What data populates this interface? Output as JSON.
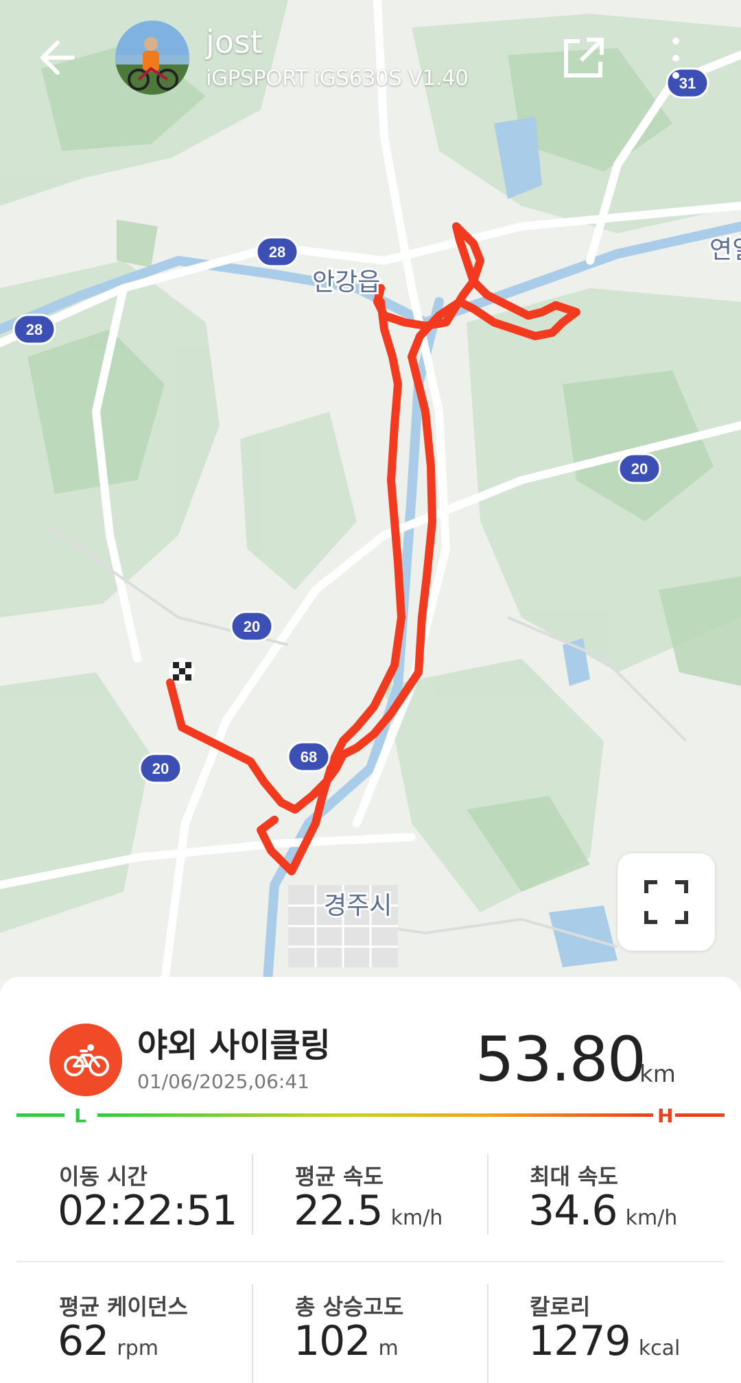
{
  "header": {
    "username": "jost",
    "device": "iGPSPORT iGS630S  V1.40"
  },
  "map": {
    "place_labels": [
      "안강읍",
      "경주시",
      "연일"
    ],
    "road_badges": [
      "28",
      "28",
      "31",
      "20",
      "20",
      "20",
      "68"
    ],
    "route_color": "#f23a1e"
  },
  "activity": {
    "name": "야외 사이클링",
    "datetime": "01/06/2025,06:41",
    "distance": "53.80",
    "distance_unit": "km",
    "hr_low": "L",
    "hr_high": "H"
  },
  "stats": [
    {
      "label": "이동 시간",
      "value": "02:22:51",
      "unit": ""
    },
    {
      "label": "평균 속도",
      "value": "22.5",
      "unit": "km/h"
    },
    {
      "label": "최대 속도",
      "value": "34.6",
      "unit": "km/h"
    },
    {
      "label": "평균 케이던스",
      "value": "62",
      "unit": "rpm"
    },
    {
      "label": "총 상승고도",
      "value": "102",
      "unit": "m"
    },
    {
      "label": "칼로리",
      "value": "1279",
      "unit": "kcal"
    }
  ],
  "colors": {
    "accent": "#f04a28",
    "hr_start": "#2ecc40",
    "hr_end": "#e8401c"
  }
}
